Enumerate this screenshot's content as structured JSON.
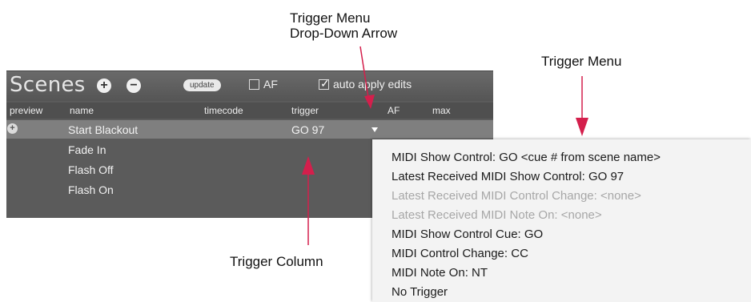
{
  "annotations": {
    "arrow_label_line1": "Trigger Menu",
    "arrow_label_line2": "Drop-Down Arrow",
    "menu_label": "Trigger Menu",
    "column_label": "Trigger Column",
    "arrow_color": "#d41f4c"
  },
  "panel": {
    "title": "Scenes",
    "add_icon": "plus-circle-icon",
    "remove_icon": "minus-circle-icon",
    "update_label": "update",
    "af_label": "AF",
    "af_checked": false,
    "auto_apply_label": "auto apply edits",
    "auto_apply_checked": true,
    "columns": {
      "preview": "preview",
      "name": "name",
      "timecode": "timecode",
      "trigger": "trigger",
      "af": "AF",
      "max": "max"
    },
    "rows": [
      {
        "name": "Start Blackout",
        "trigger": "GO 97",
        "selected": true
      },
      {
        "name": "Fade In",
        "trigger": ""
      },
      {
        "name": "Flash Off",
        "trigger": ""
      },
      {
        "name": "Flash On",
        "trigger": ""
      }
    ]
  },
  "menu": {
    "items": [
      {
        "label": "MIDI Show Control: GO <cue # from scene name>",
        "enabled": true
      },
      {
        "label": "Latest Received MIDI Show Control: GO 97",
        "enabled": true
      },
      {
        "label": "Latest Received MIDI Control Change: <none>",
        "enabled": false
      },
      {
        "label": "Latest Received MIDI Note On: <none>",
        "enabled": false
      },
      {
        "label": "MIDI Show Control Cue: GO",
        "enabled": true
      },
      {
        "label": "MIDI Control Change: CC",
        "enabled": true
      },
      {
        "label": "MIDI Note On: NT",
        "enabled": true
      },
      {
        "label": "No Trigger",
        "enabled": true
      }
    ]
  }
}
